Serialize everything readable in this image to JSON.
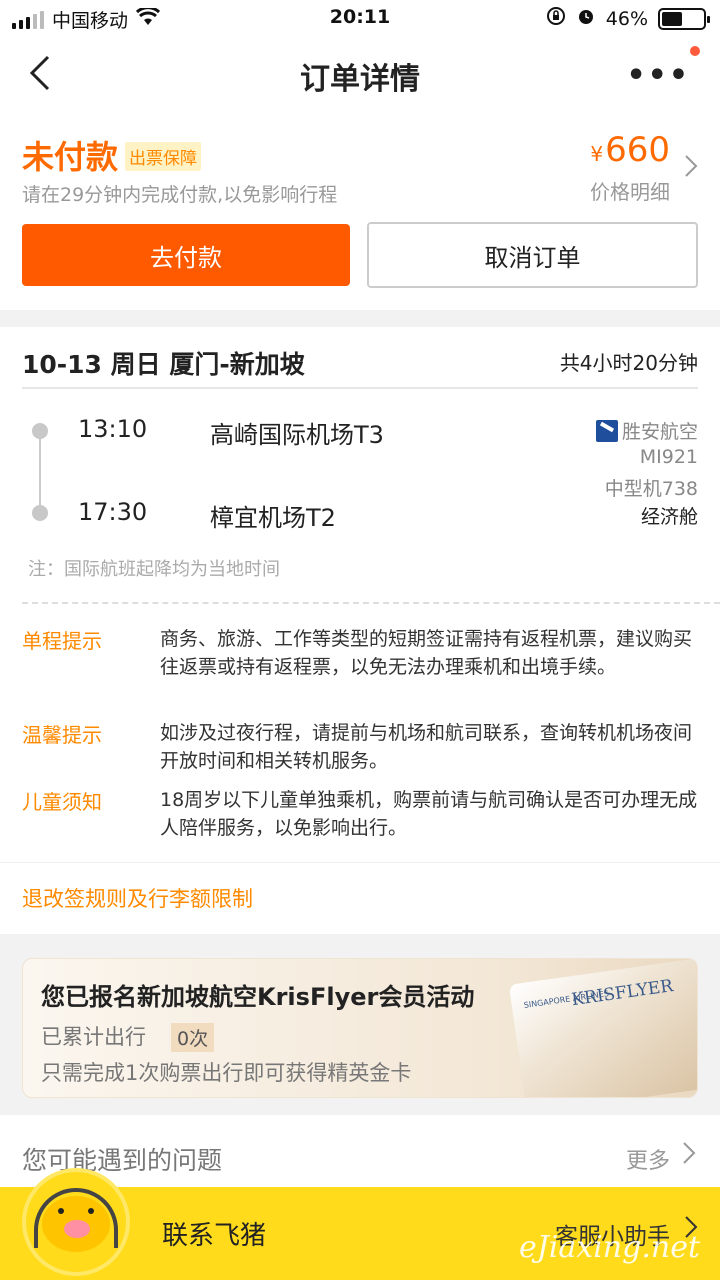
{
  "status_bar": {
    "carrier": "中国移动",
    "time": "20:11",
    "battery": "46%"
  },
  "nav": {
    "title": "订单详情",
    "more": "•••"
  },
  "payment": {
    "status": "未付款",
    "badge": "出票保障",
    "hint": "请在29分钟内完成付款,以免影响行程",
    "currency": "¥",
    "price": "660",
    "price_detail": "价格明细",
    "pay_button": "去付款",
    "cancel_button": "取消订单"
  },
  "flight": {
    "route": "10-13 周日 厦门-新加坡",
    "duration": "共4小时20分钟",
    "depart_time": "13:10",
    "depart_airport": "高崎国际机场T3",
    "arrive_time": "17:30",
    "arrive_airport": "樟宜机场T2",
    "airline": "胜安航空",
    "flight_no": "MI921",
    "aircraft": "中型机738",
    "cabin": "经济舱",
    "note": "注：国际航班起降均为当地时间"
  },
  "tips": [
    {
      "label": "单程提示",
      "text": "商务、旅游、工作等类型的短期签证需持有返程机票，建议购买往返票或持有返程票，以免无法办理乘机和出境手续。"
    },
    {
      "label": "温馨提示",
      "text": "如涉及过夜行程，请提前与机场和航司联系，查询转机机场夜间开放时间和相关转机服务。"
    },
    {
      "label": "儿童须知",
      "text": "18周岁以下儿童单独乘机，购票前请与航司确认是否可办理无成人陪伴服务，以免影响出行。"
    }
  ],
  "rules_link": "退改签规则及行李额限制",
  "krisflyer": {
    "heading": "您已报名新加坡航空KrisFlyer会员活动",
    "trips_label": "已累计出行",
    "trips_count": "0次",
    "desc": "只需完成1次购票出行即可获得精英金卡",
    "card_sia": "SINGAPORE AIRLINES",
    "card_brand": "KRISFLYER"
  },
  "faq": {
    "title": "您可能遇到的问题",
    "more": "更多"
  },
  "bottom": {
    "contact": "联系飞猪",
    "assistant": "客服小助手"
  },
  "watermark": "eJiaxing.net"
}
